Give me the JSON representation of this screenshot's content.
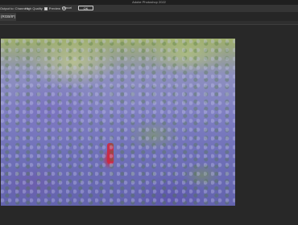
{
  "app": {
    "title": "Adobe Photoshop 2022"
  },
  "options_bar": {
    "output_label": "Output to: Channels",
    "high_quality_label": "High Quality",
    "preview_label": "Preview",
    "cancel_label": "Cancel",
    "ok_label": "OK"
  },
  "document": {
    "tab_label": "(RGB/8*)"
  },
  "colors": {
    "background": "#2b2b2b",
    "options_bar": "#353535",
    "tab_active": "#3a3a3a"
  }
}
